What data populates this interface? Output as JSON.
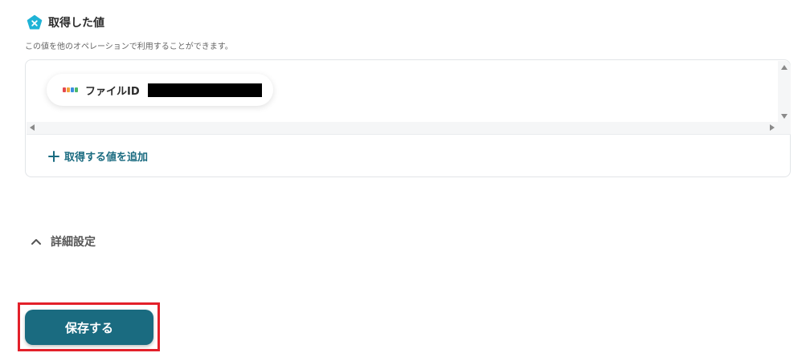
{
  "section": {
    "title": "取得した値",
    "description": "この値を他のオペレーションで利用することができます。",
    "icon": "pentagon-badge-icon"
  },
  "colors": {
    "accent": "#1a6b80",
    "icon_badge": "#1fb3d6",
    "highlight_border": "#e3202a"
  },
  "values": [
    {
      "label": "ファイルID",
      "value_redacted": true,
      "source_icon": "box-logo-icon"
    }
  ],
  "add_value": {
    "label": "取得する値を追加",
    "icon": "plus-icon"
  },
  "advanced": {
    "label": "詳細設定",
    "icon": "chevron-up-icon"
  },
  "save_button": {
    "label": "保存する"
  }
}
